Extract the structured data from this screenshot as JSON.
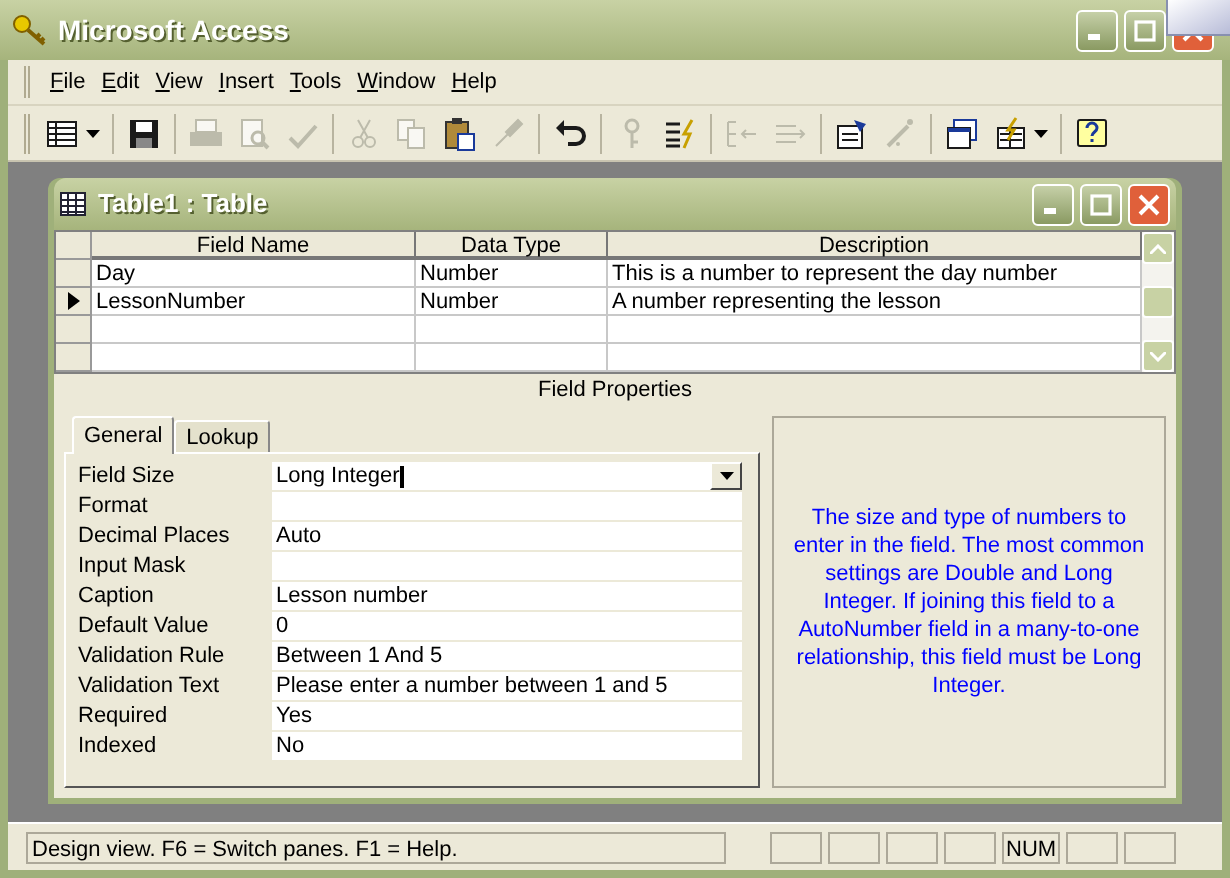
{
  "window": {
    "title": "Microsoft Access"
  },
  "menu": [
    "File",
    "Edit",
    "View",
    "Insert",
    "Tools",
    "Window",
    "Help"
  ],
  "toolbar": [
    [
      {
        "disabled": false,
        "dropdown": true
      }
    ],
    [
      {
        "disabled": false,
        "dropdown": false
      }
    ],
    [
      {
        "disabled": true,
        "dropdown": false
      },
      {
        "disabled": true,
        "dropdown": false
      },
      {
        "disabled": true,
        "dropdown": false
      }
    ],
    [
      {
        "disabled": true,
        "dropdown": false
      },
      {
        "disabled": true,
        "dropdown": false
      },
      {
        "disabled": false,
        "dropdown": false
      },
      {
        "disabled": true,
        "dropdown": false
      }
    ],
    [
      {
        "disabled": false,
        "dropdown": false
      }
    ],
    [
      {
        "disabled": true,
        "dropdown": false
      },
      {
        "disabled": false,
        "dropdown": false
      }
    ],
    [
      {
        "disabled": true,
        "dropdown": false
      },
      {
        "disabled": true,
        "dropdown": false
      }
    ],
    [
      {
        "disabled": false,
        "dropdown": false
      },
      {
        "disabled": true,
        "dropdown": false
      }
    ],
    [
      {
        "disabled": false,
        "dropdown": false
      },
      {
        "disabled": false,
        "dropdown": true
      }
    ],
    [
      {
        "disabled": false,
        "dropdown": false
      }
    ]
  ],
  "table_window": {
    "title": "Table1 : Table",
    "columns": [
      "Field Name",
      "Data Type",
      "Description"
    ],
    "rows": [
      {
        "field_name": "Day",
        "data_type": "Number",
        "description": "This is a number to represent the day number",
        "current": false
      },
      {
        "field_name": "LessonNumber",
        "data_type": "Number",
        "description": "A number representing the lesson",
        "current": true
      },
      {
        "current": false
      },
      {
        "current": false
      }
    ],
    "field_properties_title": "Field Properties",
    "tabs": [
      {
        "label": "General",
        "selected": true
      },
      {
        "label": "Lookup",
        "selected": false
      }
    ],
    "properties": [
      {
        "label": "Field Size",
        "value": "Long Integer",
        "dropdown": true
      },
      {
        "label": "Format",
        "dropdown": false
      },
      {
        "label": "Decimal Places",
        "value": "Auto",
        "dropdown": false
      },
      {
        "label": "Input Mask",
        "dropdown": false
      },
      {
        "label": "Caption",
        "value": "Lesson number",
        "dropdown": false
      },
      {
        "label": "Default Value",
        "value": "0",
        "dropdown": false
      },
      {
        "label": "Validation Rule",
        "value": "Between 1 And 5",
        "dropdown": false
      },
      {
        "label": "Validation Text",
        "value": "Please enter a number between 1 and 5",
        "dropdown": false
      },
      {
        "label": "Required",
        "value": "Yes",
        "dropdown": false
      },
      {
        "label": "Indexed",
        "value": "No",
        "dropdown": false
      }
    ],
    "help_text": "The size and type of numbers to enter in the field.  The most common settings are Double and Long Integer.  If joining this field to a AutoNumber field in a many-to-one relationship, this field must be Long Integer."
  },
  "status_bar": {
    "text": "Design view.  F6 = Switch panes.  F1 = Help.",
    "num_indicator": "NUM"
  }
}
